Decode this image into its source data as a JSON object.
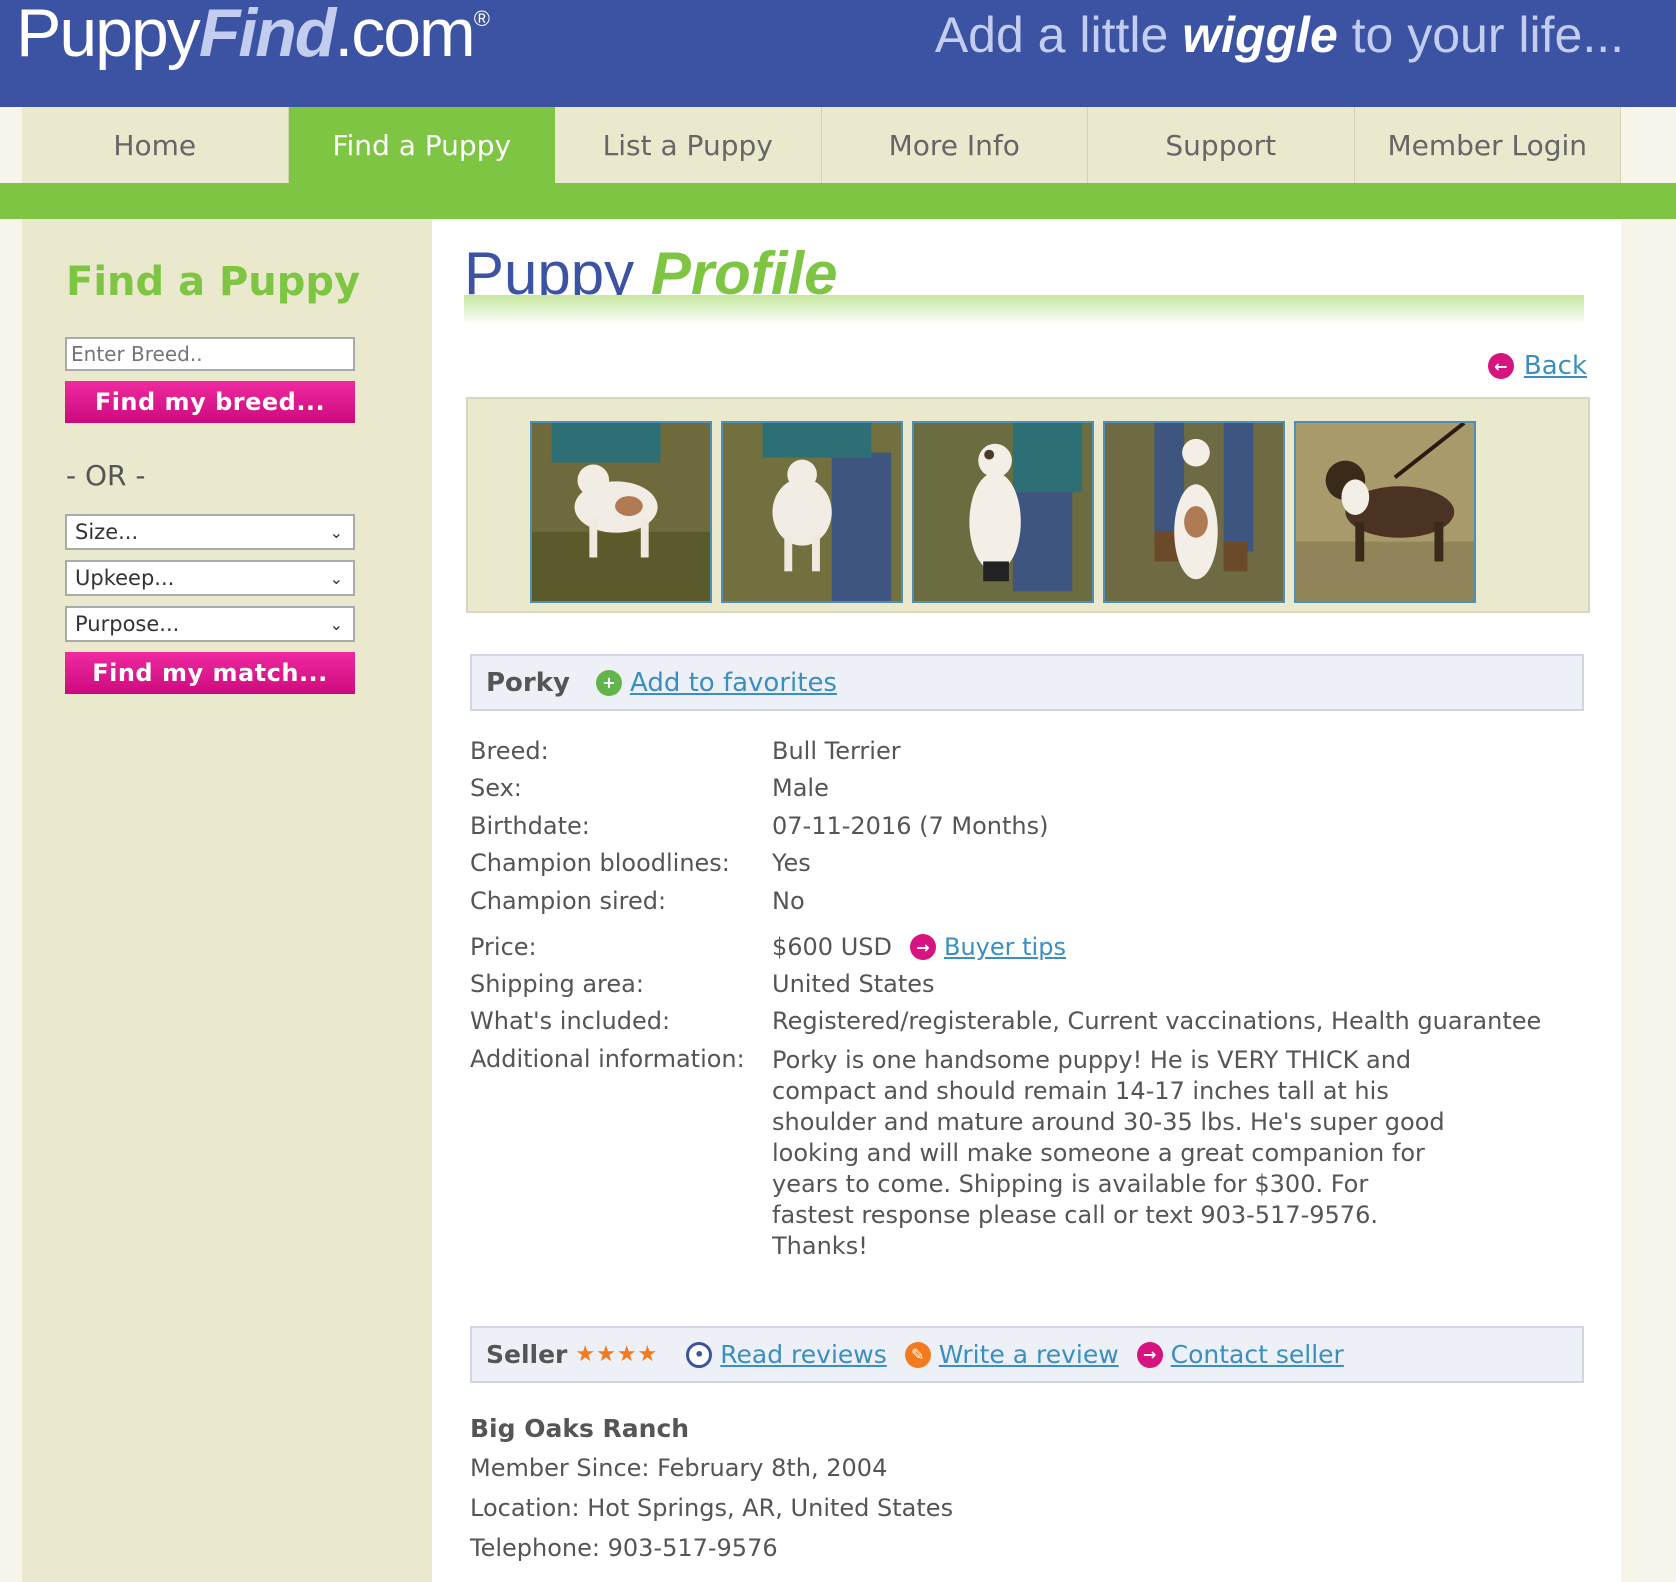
{
  "header": {
    "logo_puppy": "Puppy",
    "logo_find": "Find",
    "logo_com": ".com",
    "logo_reg": "®",
    "tagline_pre": "Add a little ",
    "tagline_bold": "wiggle",
    "tagline_post": " to your life..."
  },
  "nav": {
    "items": [
      {
        "label": "Home"
      },
      {
        "label": "Find a Puppy"
      },
      {
        "label": "List a Puppy"
      },
      {
        "label": "More Info"
      },
      {
        "label": "Support"
      },
      {
        "label": "Member Login"
      }
    ],
    "active": "Find a Puppy"
  },
  "sidebar": {
    "title": "Find a Puppy",
    "breed_placeholder": "Enter Breed..",
    "find_breed_button": "Find my breed...",
    "or_text": "- OR -",
    "size_select": "Size...",
    "upkeep_select": "Upkeep...",
    "purpose_select": "Purpose...",
    "find_match_button": "Find my match..."
  },
  "main": {
    "title_puppy": "Puppy",
    "title_profile": "Profile",
    "back_label": "Back",
    "puppy_name": "Porky",
    "add_favorites": "Add to favorites",
    "details": {
      "breed_label": "Breed:",
      "breed": "Bull Terrier",
      "sex_label": "Sex:",
      "sex": "Male",
      "birthdate_label": "Birthdate:",
      "birthdate": "07-11-2016 (7 Months)",
      "champion_bloodlines_label": "Champion bloodlines:",
      "champion_bloodlines": "Yes",
      "champion_sired_label": "Champion sired:",
      "champion_sired": "No",
      "price_label": "Price:",
      "price": "$600 USD",
      "buyer_tips": "Buyer tips",
      "shipping_label": "Shipping area:",
      "shipping": "United States",
      "included_label": "What's included:",
      "included": "Registered/registerable, Current vaccinations, Health guarantee",
      "additional_label": "Additional information:",
      "additional": "Porky is one handsome puppy! He is VERY THICK and compact and should remain 14-17 inches tall at his shoulder and mature around 30-35 lbs. He's super good looking and will make someone a great companion for years to come. Shipping is available for $300. For fastest response please call or text 903-517-9576. Thanks!"
    },
    "seller_bar": {
      "label": "Seller",
      "stars": "★★★★",
      "read_reviews": "Read reviews",
      "write_review": "Write a review",
      "contact_seller": "Contact seller"
    },
    "seller": {
      "name": "Big Oaks Ranch",
      "member_since": "Member Since: February 8th, 2004",
      "location": "Location: Hot Springs, AR, United States",
      "telephone": "Telephone: 903-517-9576"
    }
  },
  "colors": {
    "header_blue": "#3c53a3",
    "nav_green": "#7ec544",
    "sidebar_beige": "#ebe9cd",
    "button_pink": "#d6137f",
    "link_blue": "#3a8fc0"
  }
}
